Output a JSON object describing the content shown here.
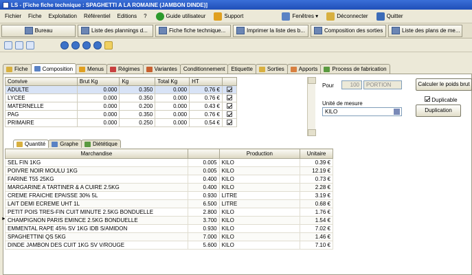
{
  "window": {
    "title": "LS - [Fiche fiche technique : SPAGHETTI A LA ROMAINE (JAMBON DINDE)]"
  },
  "menu": [
    "Fichier",
    "Fiche",
    "Exploitation",
    "Référentiel",
    "Editions",
    "?"
  ],
  "menu_buttons": {
    "guide": "Guide utilisateur",
    "support": "Support",
    "windows": "Fenêtres ▾",
    "disconnect": "Déconnecter",
    "quit": "Quitter"
  },
  "tasks": [
    "Bureau",
    "Liste des plannings d...",
    "Fiche fiche technique...",
    "Imprimer la liste des b...",
    "Composition des sorties",
    "Liste des plans de me..."
  ],
  "tabs": [
    "Fiche",
    "Composition",
    "Menus",
    "Régimes",
    "Variantes",
    "Conditionnement",
    "Etiquette",
    "Sorties",
    "Apports",
    "Process de fabrication"
  ],
  "top_grid": {
    "headers": [
      "Convive",
      "Brut Kg",
      "Kg",
      "Total Kg",
      "HT",
      ""
    ],
    "rows": [
      [
        "ADULTE",
        "0.000",
        "0.350",
        "0.000",
        "0.76 €"
      ],
      [
        "LYCEE",
        "0.000",
        "0.350",
        "0.000",
        "0.76 €"
      ],
      [
        "MATERNELLE",
        "0.000",
        "0.200",
        "0.000",
        "0.43 €"
      ],
      [
        "PAG",
        "0.000",
        "0.350",
        "0.000",
        "0.76 €"
      ],
      [
        "PRIMAIRE",
        "0.000",
        "0.250",
        "0.000",
        "0.54 €"
      ]
    ]
  },
  "right_panel": {
    "pour_label": "Pour",
    "pour_value": "100",
    "pour_unit": "PORTION",
    "calc_button": "Calculer le poids brut",
    "duplicable_label": "Duplicable",
    "unit_label": "Unité de mesure",
    "unit_value": "KILO",
    "dup_button": "Duplication"
  },
  "subtabs": [
    "Quantité",
    "Graphe",
    "Diététique"
  ],
  "bottom_grid": {
    "headers": [
      "Marchandise",
      "",
      "Production",
      "Unitaire"
    ],
    "rows": [
      [
        "SEL FIN 1KG",
        "0.005",
        "KILO",
        "0.39 €"
      ],
      [
        "POIVRE NOIR MOULU 1KG",
        "0.005",
        "KILO",
        "12.19 €"
      ],
      [
        "FARINE T55 25KG",
        "0.400",
        "KILO",
        "0.73 €"
      ],
      [
        "MARGARINE A TARTINER & A CUIRE 2.5KG",
        "0.400",
        "KILO",
        "2.28 €"
      ],
      [
        "CREME FRAICHE EPAISSE 30% 5L",
        "0.930",
        "LITRE",
        "3.19 €"
      ],
      [
        "LAIT DEMI ECREME UHT 1L",
        "6.500",
        "LITRE",
        "0.68 €"
      ],
      [
        "PETIT POIS TRES-FIN CUIT MINUTE 2.5KG BONDUELLE",
        "2.800",
        "KILO",
        "1.76 €"
      ],
      [
        "CHAMPIGNON PARIS EMINCE 2.5KG BONDUELLE",
        "3.700",
        "KILO",
        "1.54 €"
      ],
      [
        "EMMENTAL RAPE 45% SV 1KG IDB S/AMIDON",
        "0.930",
        "KILO",
        "7.02 €"
      ],
      [
        "SPAGHETTINI QS 5KG",
        "7.000",
        "KILO",
        "1.46 €"
      ],
      [
        "DINDE JAMBON DES CUIT 1KG SV V/ROUGE",
        "5.600",
        "KILO",
        "7.10 €"
      ]
    ]
  }
}
